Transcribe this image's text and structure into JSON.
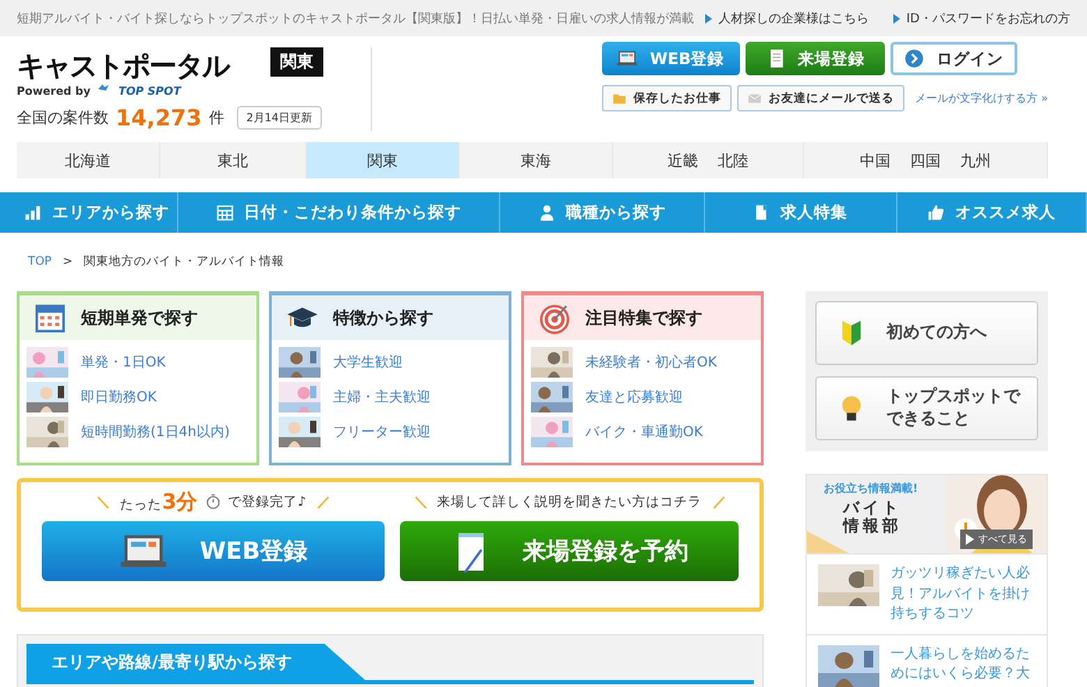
{
  "top_bar": {
    "tagline": "短期アルバイト・バイト探しならトップスポットのキャストポータル【関東版】！日払い単発・日雇いの求人情報が満載",
    "links": [
      "人材探しの企業様はこちら",
      "ID・パスワードをお忘れの方"
    ]
  },
  "header": {
    "logo": "キャストポータル",
    "powered_by": "Powered by",
    "brand": "TOP SPOT",
    "region_badge": "関東",
    "count_label": "全国の案件数",
    "count": "14,273",
    "count_unit": "件",
    "updated": "2月14日更新",
    "buttons": [
      {
        "kind": "web",
        "label": "WEB登録"
      },
      {
        "kind": "visit",
        "label": "来場登録"
      },
      {
        "kind": "login",
        "label": "ログイン"
      }
    ],
    "sub_buttons": [
      {
        "kind": "folder",
        "label": "保存したお仕事"
      },
      {
        "kind": "mail",
        "label": "お友達にメールで送る"
      }
    ],
    "help_link": "メールが文字化けする方 »"
  },
  "region_tabs": [
    {
      "labels": [
        "北海道"
      ],
      "selected": false
    },
    {
      "labels": [
        "東北"
      ],
      "selected": false
    },
    {
      "labels": [
        "関東"
      ],
      "selected": true
    },
    {
      "labels": [
        "東海"
      ],
      "selected": false
    },
    {
      "labels": [
        "近畿",
        "北陸"
      ],
      "selected": false
    },
    {
      "labels": [
        "中国",
        "四国",
        "九州"
      ],
      "selected": false
    }
  ],
  "nav": [
    {
      "kind": "chart",
      "label": "エリアから探す"
    },
    {
      "kind": "calendar",
      "label": "日付・こだわり条件から探す"
    },
    {
      "kind": "person",
      "label": "職種から探す"
    },
    {
      "kind": "book",
      "label": "求人特集"
    },
    {
      "kind": "thumb",
      "label": "オススメ求人"
    }
  ],
  "breadcrumb": {
    "items": [
      "TOP",
      "関東地方のバイト・アルバイト情報"
    ],
    "separator": ">"
  },
  "cards": [
    {
      "kind": "calendar",
      "color": "#a8dc8a",
      "title": "短期単発で探す",
      "items": [
        "単発・1日OK",
        "即日勤務OK",
        "短時間勤務(1日4h以内)"
      ]
    },
    {
      "kind": "cap",
      "color": "#7fb2d6",
      "title": "特徴から探す",
      "items": [
        "大学生歓迎",
        "主婦・主夫歓迎",
        "フリーター歓迎"
      ]
    },
    {
      "kind": "target",
      "color": "#f08a8a",
      "title": "注目特集で探す",
      "items": [
        "未経験者・初心者OK",
        "友達と応募歓迎",
        "バイク・車通勤OK"
      ]
    }
  ],
  "register": {
    "web": {
      "lead": "たった",
      "highlight": "3分",
      "tail": "で登録完了♪",
      "button": "WEB登録"
    },
    "visit": {
      "caption": "来場して詳しく説明を聞きたい方はコチラ",
      "button": "来場登録を予約"
    }
  },
  "area_section": {
    "title": "エリアや路線/最寄り駅から探す"
  },
  "side_buttons": [
    {
      "kind": "beginner",
      "lines": [
        "初めての方へ"
      ]
    },
    {
      "kind": "bulb",
      "lines": [
        "トップスポットで",
        "できること"
      ]
    }
  ],
  "info_banner": {
    "tagline": "お役立ち情報満載!",
    "title_lines": [
      "バイト",
      "情報部"
    ],
    "more": "すべて見る"
  },
  "articles": [
    {
      "title": "ガッツリ稼ぎたい人必見！アルバイトを掛け持ちするコツ"
    },
    {
      "title": "一人暮らしを始めるためにはいくら必要？大"
    }
  ]
}
